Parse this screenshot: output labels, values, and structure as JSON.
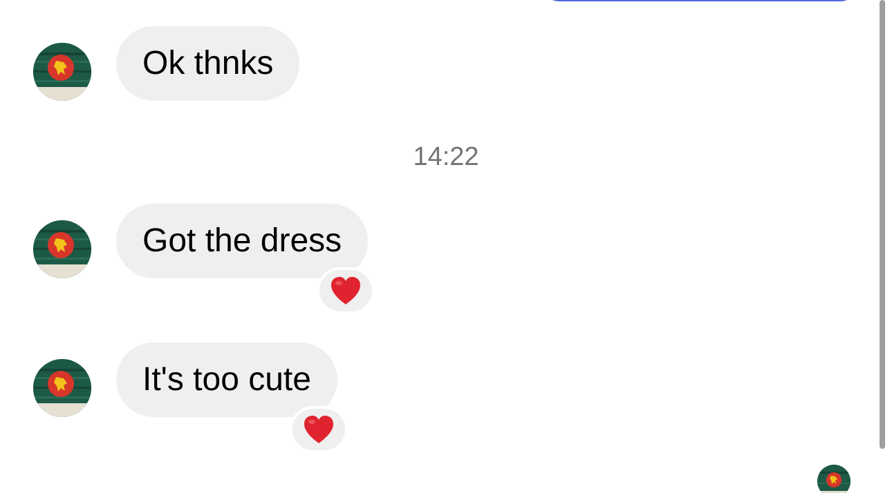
{
  "conversation": {
    "timestamp": "14:22",
    "messages": [
      {
        "text": "Ok thnks",
        "reaction": null
      },
      {
        "text": "Got the dress",
        "reaction": "heart-icon"
      },
      {
        "text": "It's too cute",
        "reaction": "heart-icon"
      }
    ]
  },
  "colors": {
    "incoming_bubble": "#efefef",
    "outgoing_bubble": "#4f67dc",
    "timestamp_text": "#737373",
    "heart": "#e0242f",
    "avatar_green": "#1d5a46",
    "avatar_red": "#d8362b",
    "avatar_yellow": "#f3c21b"
  },
  "icons": {
    "avatar": "flag-avatar",
    "reaction": "heart-icon"
  }
}
